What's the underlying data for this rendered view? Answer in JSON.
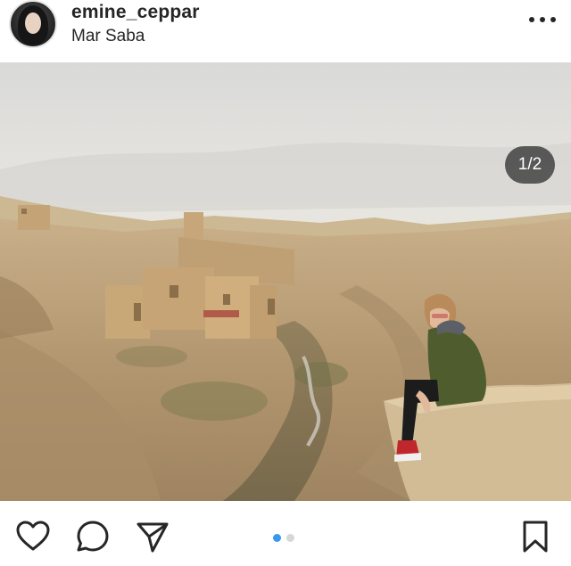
{
  "post": {
    "username": "emine_ceppar",
    "location": "Mar Saba",
    "carousel": {
      "counter": "1/2",
      "current": 1,
      "total": 2
    }
  },
  "icons": {
    "more": "more-options-icon",
    "like": "heart-icon",
    "comment": "comment-icon",
    "share": "send-icon",
    "save": "bookmark-icon"
  },
  "colors": {
    "text": "#262626",
    "active_dot": "#3897f0",
    "inactive_dot": "#d7d7d7"
  }
}
